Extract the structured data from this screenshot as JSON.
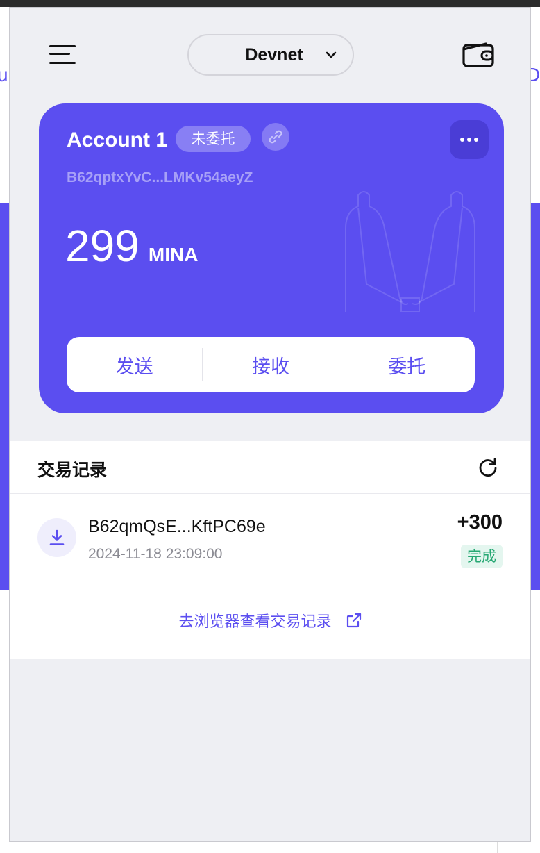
{
  "header": {
    "network": "Devnet"
  },
  "account": {
    "name": "Account 1",
    "delegation_badge": "未委托",
    "address": "B62qptxYvC...LMKv54aeyZ",
    "balance": "299",
    "unit": "MINA",
    "actions": {
      "send": "发送",
      "receive": "接收",
      "delegate": "委托"
    }
  },
  "transactions": {
    "title": "交易记录",
    "items": [
      {
        "address": "B62qmQsE...KftPC69e",
        "time": "2024-11-18 23:09:00",
        "amount": "+300",
        "status": "完成",
        "icon": "receive-arrow-icon"
      }
    ],
    "explorer_link": "去浏览器查看交易记录"
  },
  "colors": {
    "accent": "#5b4ef0",
    "accent_dark": "#4a3dd6",
    "popup_bg": "#eeeff3",
    "status_success": "#26a873",
    "status_success_bg": "#e4f6ef"
  }
}
